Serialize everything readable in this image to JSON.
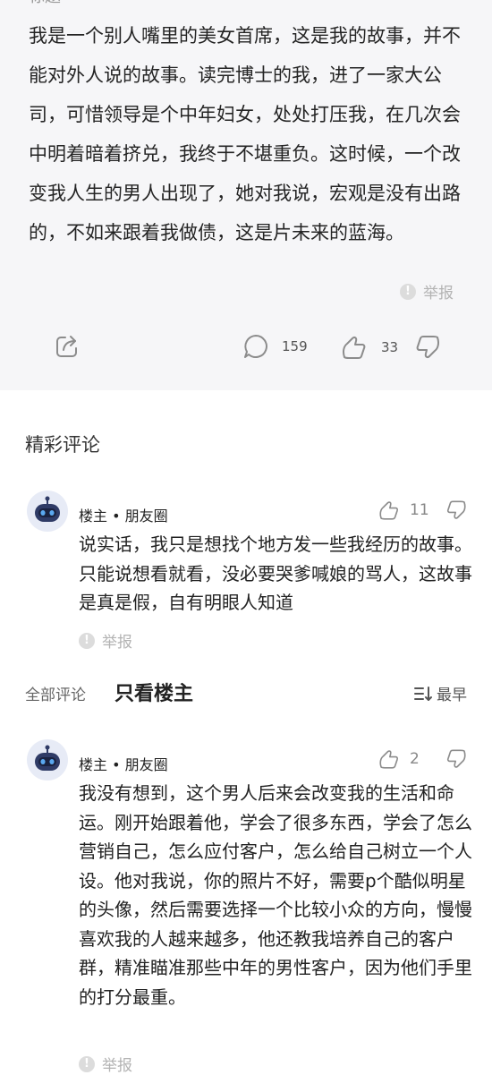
{
  "post": {
    "cut_title": "标题",
    "body": "我是一个别人嘴里的美女首席，这是我的故事，并不能对外人说的故事。读完博士的我，进了一家大公司，可惜领导是个中年妇女，处处打压我，在几次会中明着暗着挤兑，我终于不堪重负。这时候，一个改变我人生的男人出现了，她对我说，宏观是没有出路的，不如来跟着我做债，这是片未来的蓝海。",
    "report_label": "举报",
    "comment_count": "159",
    "like_count": "33"
  },
  "section": {
    "title": "精彩评论"
  },
  "featured_comment": {
    "author": "楼主 • 朋友圈",
    "likes": "11",
    "text": "说实话，我只是想找个地方发一些我经历的故事。只能说想看就看，没必要哭爹喊娘的骂人，这故事是真是假，自有明眼人知道",
    "report_label": "举报"
  },
  "tabs": {
    "all_label": "全部评论",
    "owner_label": "只看楼主",
    "sort_label": "最早"
  },
  "comment2": {
    "author": "楼主 • 朋友圈",
    "likes": "2",
    "text": "我没有想到，这个男人后来会改变我的生活和命运。刚开始跟着他，学会了很多东西，学会了怎么营销自己，怎么应付客户，怎么给自己树立一个人设。他对我说，你的照片不好，需要p个酷似明星的头像，然后需要选择一个比较小众的方向，慢慢喜欢我的人越来越多，他还教我培养自己的客户群，精准瞄准那些中年的男性客户，因为他们手里的打分最重。",
    "report_label": "举报"
  },
  "colors": {
    "post_background": "#f6f6f8",
    "avatar_background": "#e7ebf6",
    "avatar_face": "#2f3b66",
    "avatar_eyes": "#5aa8f0"
  },
  "icons": [
    "share-icon",
    "comment-icon",
    "thumbs-up-icon",
    "thumbs-down-icon",
    "warning-icon",
    "sort-icon",
    "robot-avatar-icon"
  ]
}
